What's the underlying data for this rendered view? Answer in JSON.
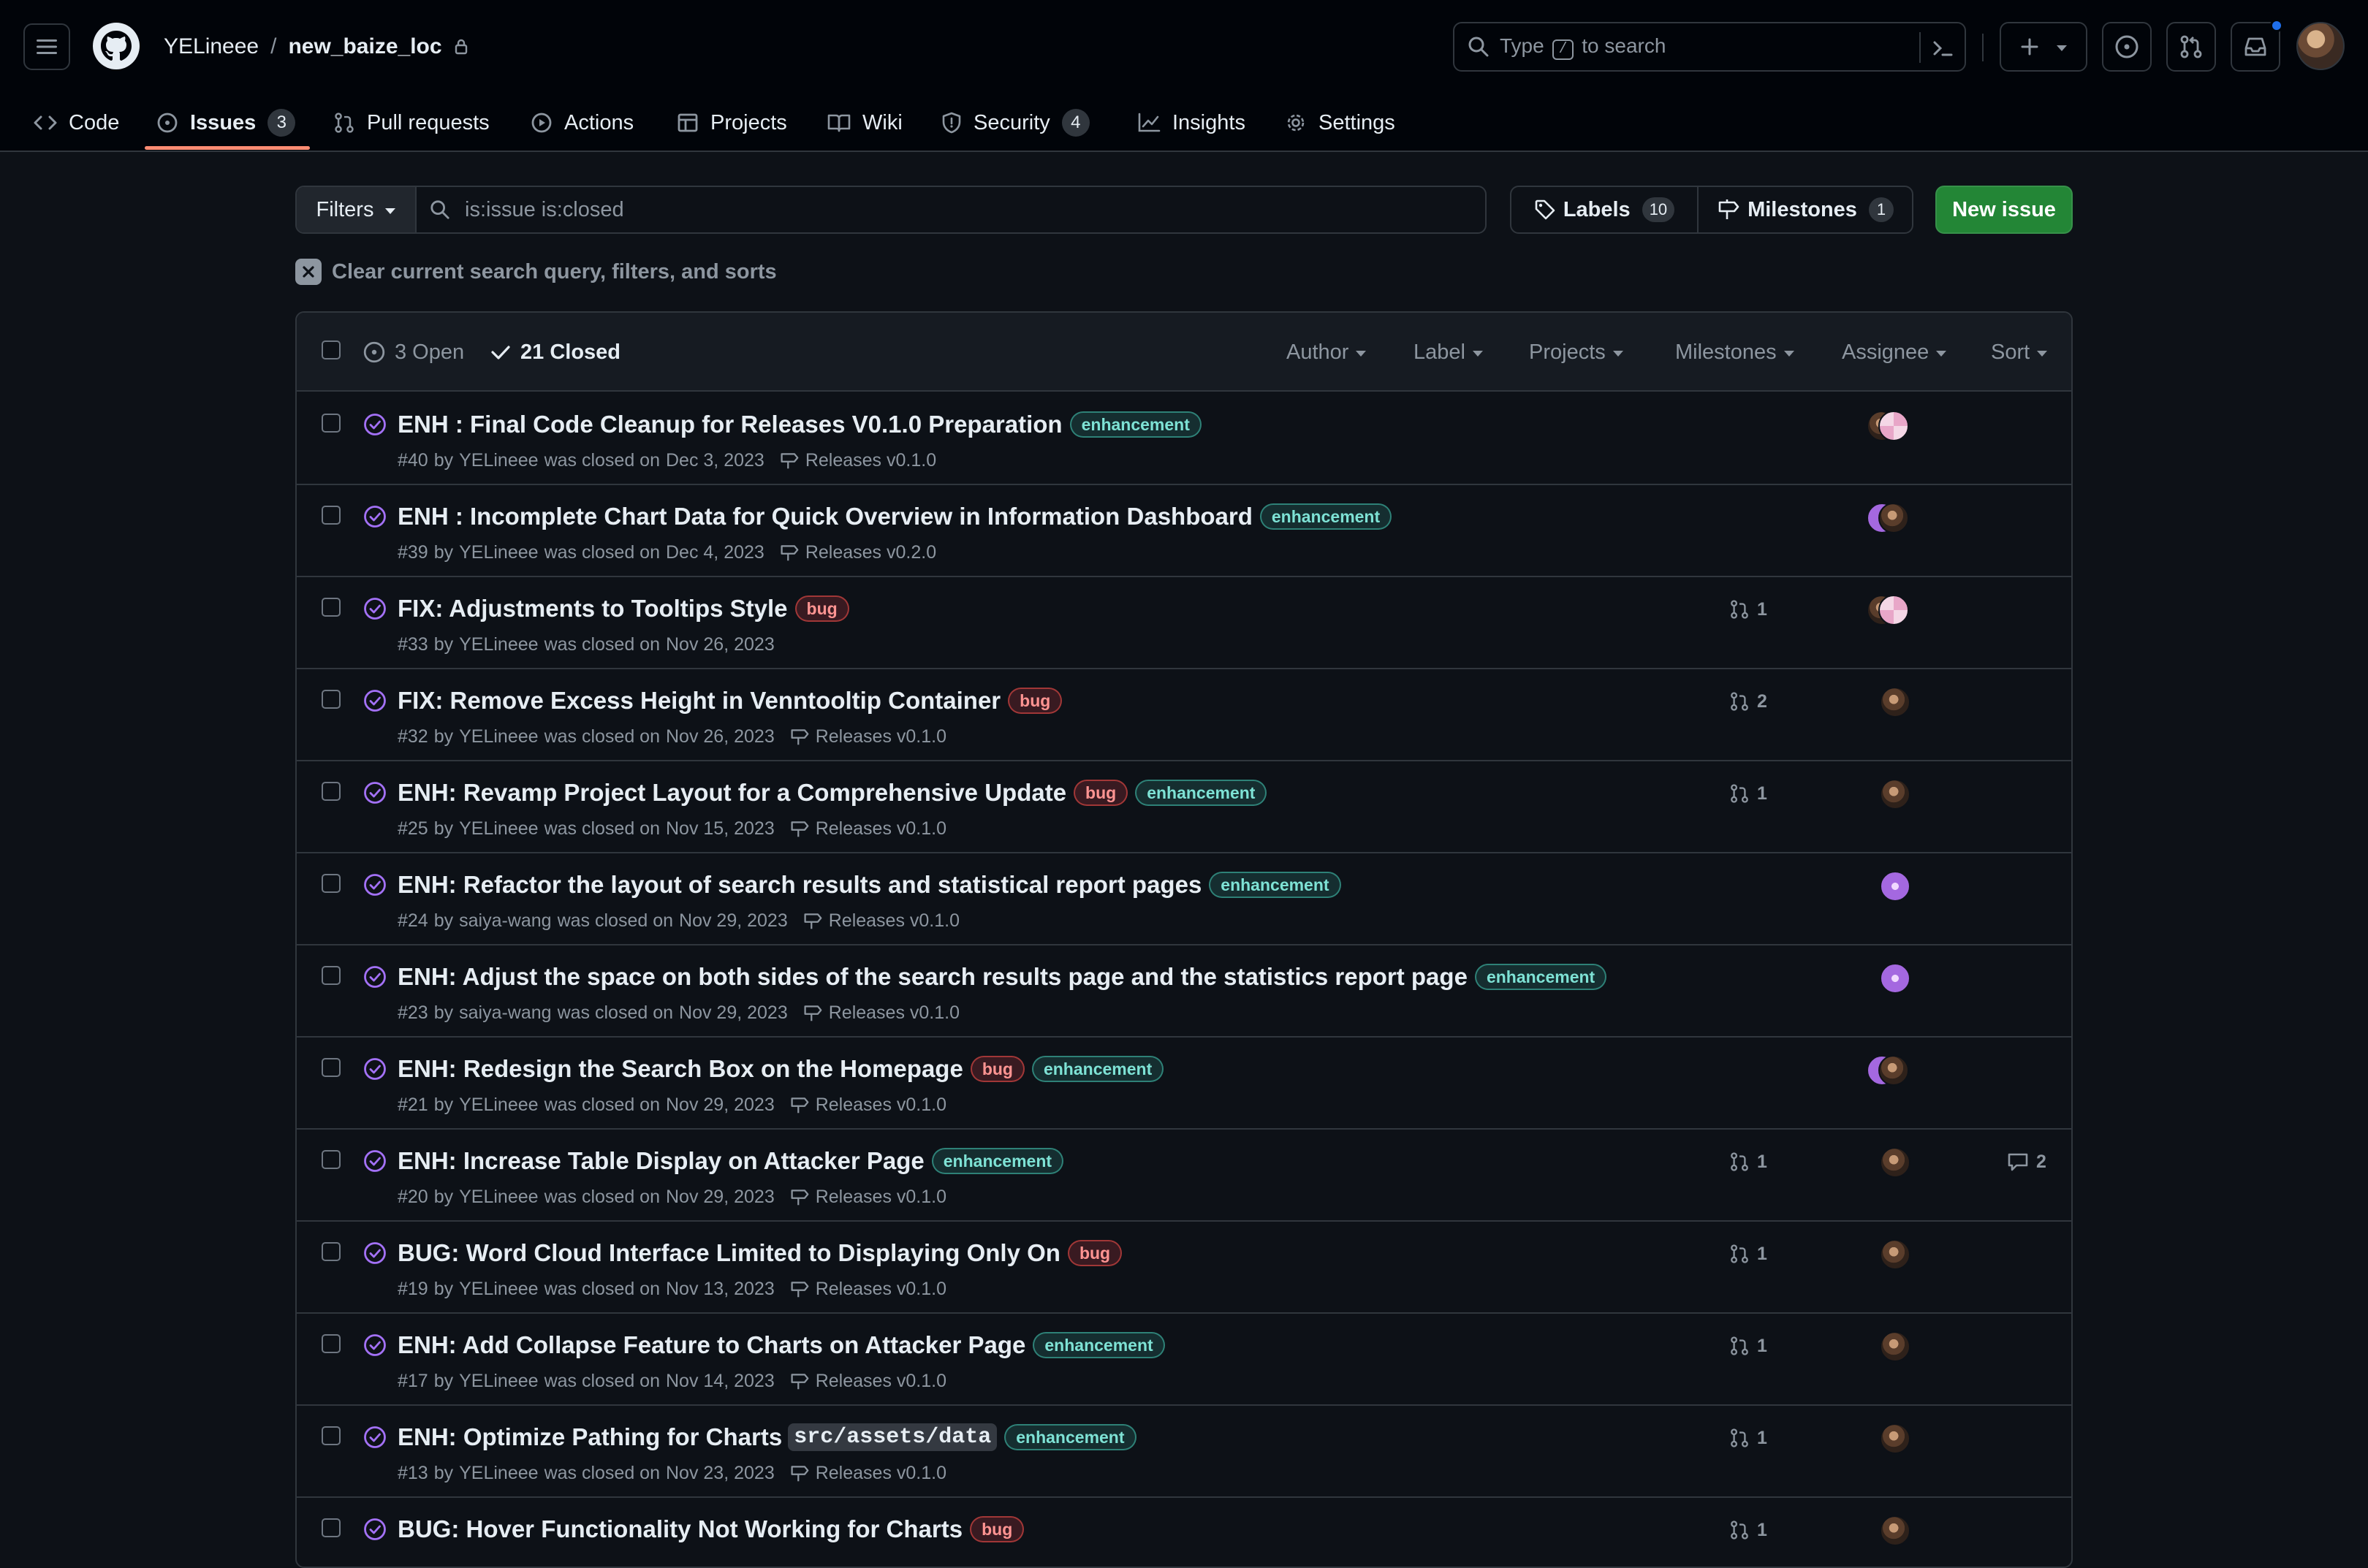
{
  "repo": {
    "owner": "YELineee",
    "name": "new_baize_loc"
  },
  "search": {
    "prefix": "Type",
    "key": "/",
    "suffix": "to search"
  },
  "nav": {
    "tabs": [
      {
        "label": "Code"
      },
      {
        "label": "Issues",
        "count": "3"
      },
      {
        "label": "Pull requests"
      },
      {
        "label": "Actions"
      },
      {
        "label": "Projects"
      },
      {
        "label": "Wiki"
      },
      {
        "label": "Security",
        "count": "4"
      },
      {
        "label": "Insights"
      },
      {
        "label": "Settings"
      }
    ]
  },
  "toolbar": {
    "filters_label": "Filters",
    "query": "is:issue is:closed",
    "labels_label": "Labels",
    "labels_count": "10",
    "milestones_label": "Milestones",
    "milestones_count": "1",
    "new_issue_label": "New issue",
    "clear_label": "Clear current search query, filters, and sorts"
  },
  "list_header": {
    "open_label": "3 Open",
    "closed_label": "21 Closed",
    "filters": [
      "Author",
      "Label",
      "Projects",
      "Milestones",
      "Assignee",
      "Sort"
    ]
  },
  "colors": {
    "accent_underline": "#fd8c73",
    "closed_icon": "#a371f7",
    "new_issue_bg": "#238636"
  },
  "issues": [
    {
      "title": "ENH : Final Code Cleanup for Releases V0.1.0 Preparation",
      "labels": [
        "enhancement"
      ],
      "number": "#40",
      "author": "YELineee",
      "closed_on": "Dec 3, 2023",
      "milestone": "Releases v0.1.0",
      "prs": "",
      "comments": ""
    },
    {
      "title": "ENH : Incomplete Chart Data for Quick Overview in Information Dashboard",
      "labels": [
        "enhancement"
      ],
      "number": "#39",
      "author": "YELineee",
      "closed_on": "Dec 4, 2023",
      "milestone": "Releases v0.2.0",
      "prs": "",
      "comments": ""
    },
    {
      "title": "FIX: Adjustments to Tooltips Style",
      "labels": [
        "bug"
      ],
      "number": "#33",
      "author": "YELineee",
      "closed_on": "Nov 26, 2023",
      "milestone": "",
      "prs": "1",
      "comments": ""
    },
    {
      "title": "FIX: Remove Excess Height in Venntooltip Container",
      "labels": [
        "bug"
      ],
      "number": "#32",
      "author": "YELineee",
      "closed_on": "Nov 26, 2023",
      "milestone": "Releases v0.1.0",
      "prs": "2",
      "comments": ""
    },
    {
      "title": "ENH: Revamp Project Layout for a Comprehensive Update",
      "labels": [
        "bug",
        "enhancement"
      ],
      "number": "#25",
      "author": "YELineee",
      "closed_on": "Nov 15, 2023",
      "milestone": "Releases v0.1.0",
      "prs": "1",
      "comments": ""
    },
    {
      "title": "ENH: Refactor the layout of search results and statistical report pages",
      "labels": [
        "enhancement"
      ],
      "number": "#24",
      "author": "saiya-wang",
      "closed_on": "Nov 29, 2023",
      "milestone": "Releases v0.1.0",
      "prs": "",
      "comments": ""
    },
    {
      "title": "ENH: Adjust the space on both sides of the search results page and the statistics report page",
      "labels": [
        "enhancement"
      ],
      "number": "#23",
      "author": "saiya-wang",
      "closed_on": "Nov 29, 2023",
      "milestone": "Releases v0.1.0",
      "prs": "",
      "comments": ""
    },
    {
      "title": "ENH: Redesign the Search Box on the Homepage",
      "labels": [
        "bug",
        "enhancement"
      ],
      "number": "#21",
      "author": "YELineee",
      "closed_on": "Nov 29, 2023",
      "milestone": "Releases v0.1.0",
      "prs": "",
      "comments": ""
    },
    {
      "title": "ENH: Increase Table Display on Attacker Page",
      "labels": [
        "enhancement"
      ],
      "number": "#20",
      "author": "YELineee",
      "closed_on": "Nov 29, 2023",
      "milestone": "Releases v0.1.0",
      "prs": "1",
      "comments": "2"
    },
    {
      "title": "BUG: Word Cloud Interface Limited to Displaying Only On",
      "labels": [
        "bug"
      ],
      "number": "#19",
      "author": "YELineee",
      "closed_on": "Nov 13, 2023",
      "milestone": "Releases v0.1.0",
      "prs": "1",
      "comments": ""
    },
    {
      "title": "ENH: Add Collapse Feature to Charts on Attacker Page",
      "labels": [
        "enhancement"
      ],
      "number": "#17",
      "author": "YELineee",
      "closed_on": "Nov 14, 2023",
      "milestone": "Releases v0.1.0",
      "prs": "1",
      "comments": ""
    },
    {
      "title": "ENH: Optimize Pathing for Charts",
      "code": "src/assets/data",
      "labels": [
        "enhancement"
      ],
      "number": "#13",
      "author": "YELineee",
      "closed_on": "Nov 23, 2023",
      "milestone": "Releases v0.1.0",
      "prs": "1",
      "comments": ""
    },
    {
      "title": "BUG: Hover Functionality Not Working for Charts",
      "labels": [
        "bug"
      ],
      "number": "",
      "author": "",
      "closed_on": "",
      "milestone": "",
      "prs": "1",
      "comments": ""
    }
  ],
  "meta_text": {
    "by": "by",
    "was_closed_on": "was closed on"
  }
}
